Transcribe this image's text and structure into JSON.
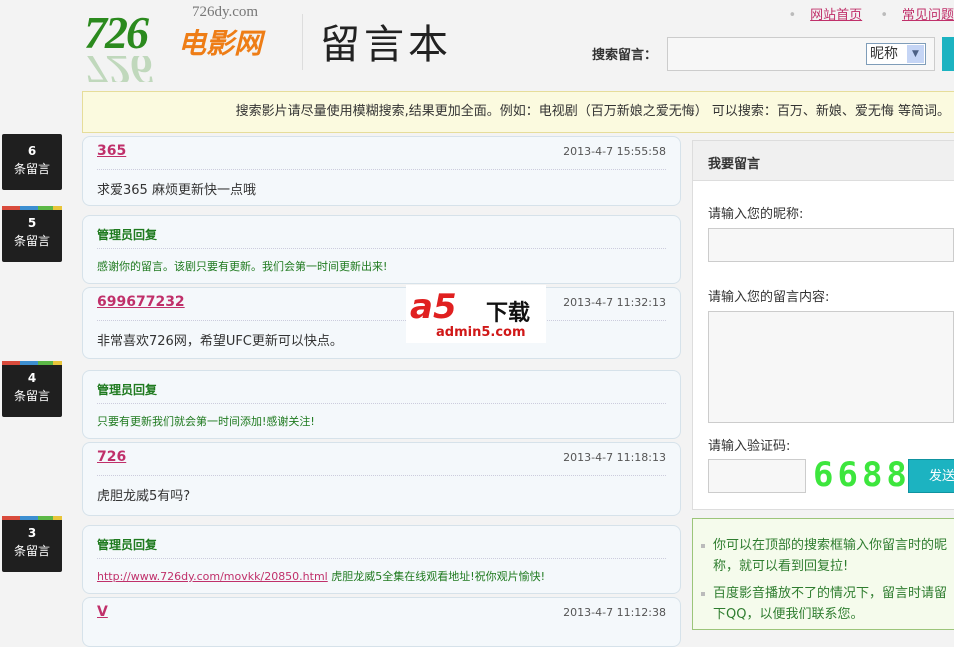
{
  "header": {
    "logo_num": "726",
    "logo_cn": "电影网",
    "logo_domain": "726dy.com",
    "page_title": "留言本",
    "links": [
      "网站首页",
      "常见问题"
    ]
  },
  "search": {
    "label": "搜索留言：",
    "value": "",
    "select": "昵称"
  },
  "notice": "搜索影片请尽量使用模糊搜索,结果更加全面。例如：电视剧（百万新娘之爱无悔） 可以搜索：百万、新娘、爱无悔 等简词。",
  "badges": [
    {
      "count": "6",
      "label": "条留言"
    },
    {
      "count": "5",
      "label": "条留言"
    },
    {
      "count": "4",
      "label": "条留言"
    },
    {
      "count": "3",
      "label": "条留言"
    }
  ],
  "posts": [
    {
      "name": "365",
      "time": "2013-4-7 15:55:58",
      "message": "求爱365 麻烦更新快一点哦",
      "reply_title": "管理员回复",
      "reply": "感谢你的留言。该剧只要有更新。我们会第一时间更新出来!"
    },
    {
      "name": "699677232",
      "time": "2013-4-7 11:32:13",
      "message": "非常喜欢726网，希望UFC更新可以快点。",
      "reply_title": "管理员回复",
      "reply": "只要有更新我们就会第一时间添加!感谢关注!"
    },
    {
      "name": "726",
      "time": "2013-4-7 11:18:13",
      "message": "虎胆龙威5有吗?",
      "reply_title": "管理员回复",
      "reply_link": "http://www.726dy.com/movkk/20850.html",
      "reply": " 虎胆龙威5全集在线观看地址!祝你观片愉快!"
    },
    {
      "name": "V",
      "time": "2013-4-7 11:12:38"
    }
  ],
  "watermark": {
    "logo": "a5",
    "text": "下载",
    "domain": "admin5.com"
  },
  "form": {
    "title": "我要留言",
    "nickname_label": "请输入您的昵称:",
    "content_label": "请输入您的留言内容:",
    "captcha_label": "请输入验证码:",
    "captcha": "6688",
    "send": "发送"
  },
  "tips": [
    "你可以在顶部的搜索框输入你留言时的昵称，就可以看到回复拉!",
    "百度影音播放不了的情况下，留言时请留下QQ，以便我们联系您。"
  ]
}
